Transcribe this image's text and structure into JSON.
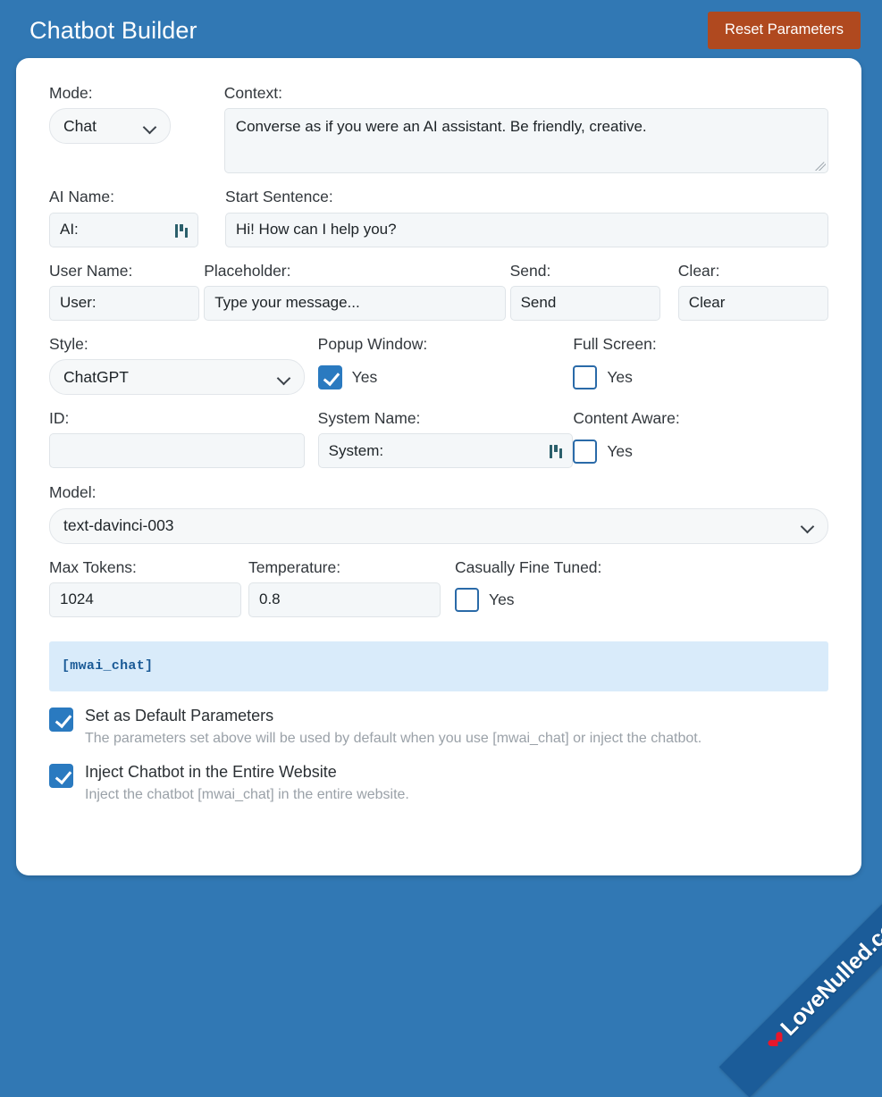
{
  "header": {
    "title": "Chatbot Builder",
    "reset_label": "Reset Parameters"
  },
  "form": {
    "mode": {
      "label": "Mode:",
      "value": "Chat"
    },
    "context": {
      "label": "Context:",
      "value": "Converse as if you were an AI assistant. Be friendly, creative."
    },
    "ai_name": {
      "label": "AI Name:",
      "value": "AI:"
    },
    "start_sentence": {
      "label": "Start Sentence:",
      "value": "Hi! How can I help you?"
    },
    "user_name": {
      "label": "User Name:",
      "value": "User:"
    },
    "placeholder": {
      "label": "Placeholder:",
      "value": "Type your message..."
    },
    "send": {
      "label": "Send:",
      "value": "Send"
    },
    "clear": {
      "label": "Clear:",
      "value": "Clear"
    },
    "style": {
      "label": "Style:",
      "value": "ChatGPT"
    },
    "popup_window": {
      "label": "Popup Window:",
      "checkbox_label": "Yes",
      "checked": true
    },
    "full_screen": {
      "label": "Full Screen:",
      "checkbox_label": "Yes",
      "checked": false
    },
    "id": {
      "label": "ID:",
      "value": ""
    },
    "system_name": {
      "label": "System Name:",
      "value": "System:"
    },
    "content_aware": {
      "label": "Content Aware:",
      "checkbox_label": "Yes",
      "checked": false
    },
    "model": {
      "label": "Model:",
      "value": "text-davinci-003"
    },
    "max_tokens": {
      "label": "Max Tokens:",
      "value": "1024"
    },
    "temperature": {
      "label": "Temperature:",
      "value": "0.8"
    },
    "casually_fine_tuned": {
      "label": "Casually Fine Tuned:",
      "checkbox_label": "Yes",
      "checked": false
    }
  },
  "shortcode": "[mwai_chat]",
  "options": [
    {
      "title": "Set as Default Parameters",
      "description": "The parameters set above will be used by default when you use [mwai_chat] or inject the chatbot.",
      "checked": true
    },
    {
      "title": "Inject Chatbot in the Entire Website",
      "description": "Inject the chatbot [mwai_chat] in the entire website.",
      "checked": true
    }
  ],
  "watermark": {
    "text": "LoveNulled.com"
  },
  "colors": {
    "page_background": "#3178b4",
    "reset_button": "#b0491f",
    "accent_checkbox": "#2a7ac0",
    "shortcode_background": "#d9ebfa",
    "shortcode_text": "#1a5a96"
  }
}
